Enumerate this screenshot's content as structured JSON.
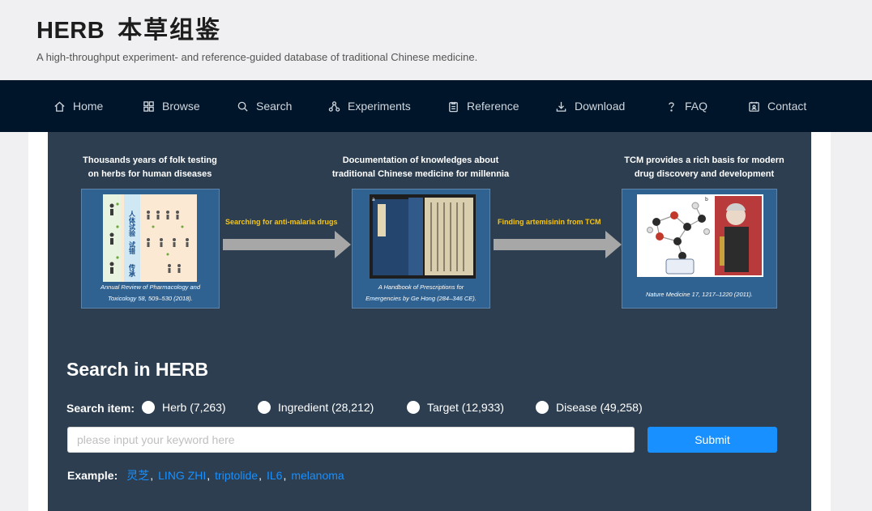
{
  "header": {
    "title_en": "HERB",
    "title_zh": "本草组鉴",
    "tagline": "A high-throughput experiment- and reference-guided database of traditional Chinese medicine."
  },
  "nav": [
    {
      "label": "Home",
      "icon": "home-icon"
    },
    {
      "label": "Browse",
      "icon": "grid-icon"
    },
    {
      "label": "Search",
      "icon": "search-icon"
    },
    {
      "label": "Experiments",
      "icon": "network-icon"
    },
    {
      "label": "Reference",
      "icon": "document-icon"
    },
    {
      "label": "Download",
      "icon": "download-icon"
    },
    {
      "label": "FAQ",
      "icon": "question-icon"
    },
    {
      "label": "Contact",
      "icon": "contact-icon"
    }
  ],
  "banner": {
    "stage1": {
      "title_line1": "Thousands years of folk testing",
      "title_line2": "on herbs for human diseases",
      "caption_line1": "Annual Review of Pharmacology and",
      "caption_line2": "Toxicology 58, 509–530 (2018)."
    },
    "stage2": {
      "title_line1": "Documentation of knowledges about",
      "title_line2": "traditional Chinese medicine for millennia",
      "caption_line1": "A Handbook of Prescriptions for",
      "caption_line2": "Emergencies by Ge Hong (284–346 CE)."
    },
    "stage3": {
      "title_line1": "TCM provides a rich basis for modern",
      "title_line2": "drug discovery and development",
      "caption_line1": "Nature Medicine 17, 1217–1220 (2011)."
    },
    "arrow1_label": "Searching for anti-malaria drugs",
    "arrow2_label": "Finding artemisinin from TCM",
    "figure_zh_1": "人体试验",
    "figure_zh_2": "试错",
    "figure_zh_3": "传承",
    "panel2_letter": "a",
    "panel3_letter": "b",
    "colors": {
      "arrow_label": "#f5c518",
      "panel_bg": "#2f6290"
    }
  },
  "search": {
    "title": "Search in HERB",
    "item_label": "Search item:",
    "options": [
      {
        "label": "Herb (7,263)"
      },
      {
        "label": "Ingredient (28,212)"
      },
      {
        "label": "Target (12,933)"
      },
      {
        "label": "Disease (49,258)"
      }
    ],
    "input_value": "",
    "input_placeholder": "please input your keyword here",
    "submit_label": "Submit",
    "example_label": "Example:",
    "examples": [
      "灵芝",
      "LING ZHI",
      "triptolide",
      "IL6",
      "melanoma"
    ]
  },
  "colors": {
    "navbar": "#001529",
    "main": "#2c3e50",
    "accent": "#1890ff"
  }
}
